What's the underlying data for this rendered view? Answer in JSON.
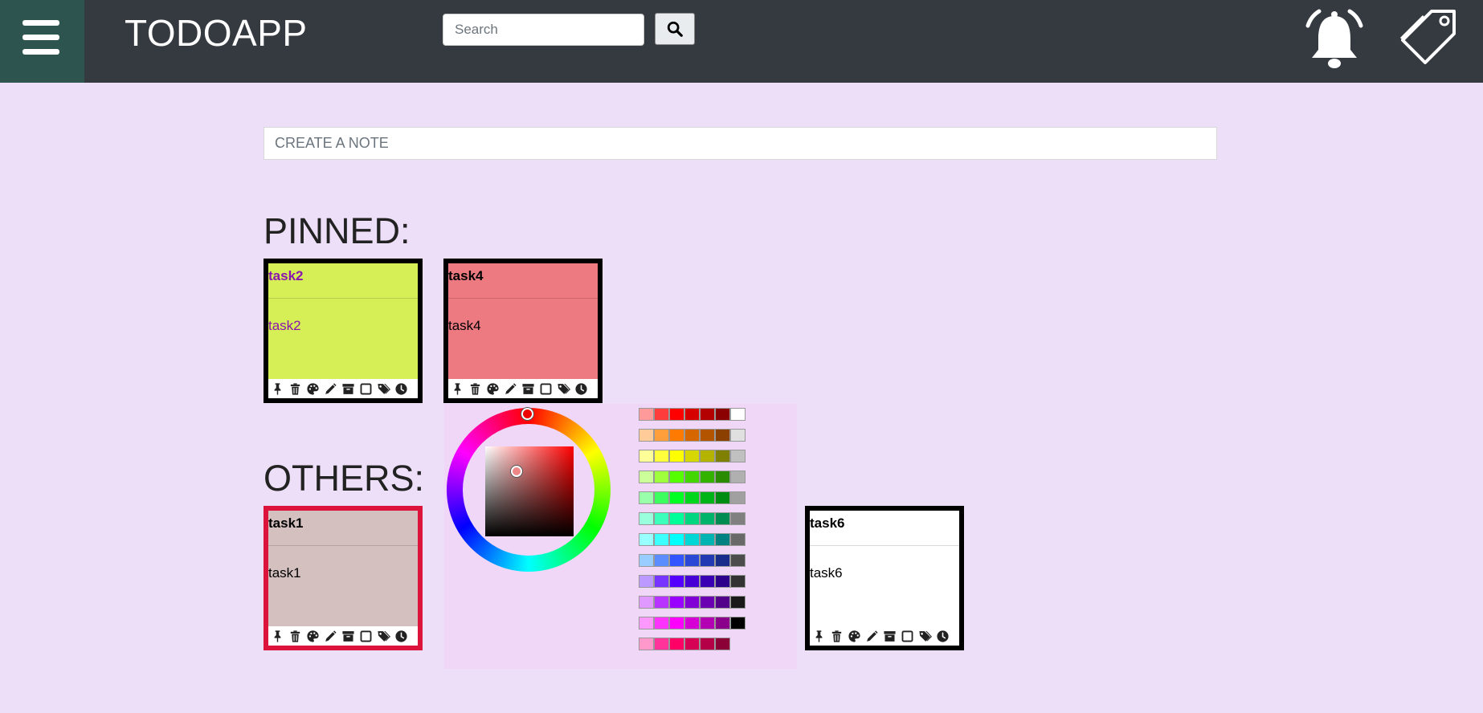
{
  "header": {
    "title": "TODOAPP",
    "search_placeholder": "Search",
    "colors": {
      "bar": "#343a40",
      "menu": "#2d544e"
    }
  },
  "create_note": {
    "placeholder": "CREATE A NOTE"
  },
  "sections": {
    "pinned": "PINNED:",
    "others": "OTHERS:"
  },
  "notes": {
    "task2": {
      "title": "task2",
      "text": "task2",
      "bg": "#d6ef56",
      "fg": "#8a14b0",
      "border": "#000000"
    },
    "task4": {
      "title": "task4",
      "text": "task4",
      "bg": "#ec7a80",
      "fg": "#000000",
      "border": "#000000"
    },
    "task1": {
      "title": "task1",
      "text": "task1",
      "bg": "#d3c0bf",
      "fg": "#000000",
      "border": "#dc143c"
    },
    "task6": {
      "title": "task6",
      "text": "task6",
      "bg": "#ffffff",
      "fg": "#000000",
      "border": "#000000"
    }
  },
  "note_toolbar_icons": [
    "pin-icon",
    "trash-icon",
    "palette-icon",
    "pencil-icon",
    "archive-icon",
    "checkbox-icon",
    "tags-icon",
    "clock-icon"
  ],
  "color_picker": {
    "selected_hue": "#ff0000",
    "swatches": [
      [
        "#ff9a9a",
        "#ff3c3c",
        "#ff0000",
        "#d60000",
        "#b30000",
        "#8b0000",
        "#ffffff"
      ],
      [
        "#ffcc99",
        "#ff9f3c",
        "#ff7a00",
        "#d66600",
        "#b35500",
        "#8b4000",
        "#e0e0e0"
      ],
      [
        "#ffff99",
        "#ffff3c",
        "#ffff00",
        "#d6d600",
        "#b3b300",
        "#808000",
        "#c0c0c0"
      ],
      [
        "#ccff99",
        "#9fff3c",
        "#55ff00",
        "#44d600",
        "#33b300",
        "#2b8b00",
        "#b0b0b0"
      ],
      [
        "#99ffaa",
        "#3cff5f",
        "#00ff22",
        "#00d61c",
        "#00b317",
        "#008b12",
        "#a0a0a0"
      ],
      [
        "#99ffdd",
        "#3cffbb",
        "#00ff99",
        "#00d680",
        "#00b36b",
        "#008b53",
        "#808080"
      ],
      [
        "#99ffff",
        "#3cffff",
        "#00ffff",
        "#00d6d6",
        "#00b3b3",
        "#008080",
        "#696969"
      ],
      [
        "#99ccff",
        "#5c8dff",
        "#3355ff",
        "#2b47d6",
        "#2239b3",
        "#1a2c8b",
        "#4c4c4c"
      ],
      [
        "#bb99ff",
        "#7733ff",
        "#5500ff",
        "#4600d6",
        "#3a00b3",
        "#2d008b",
        "#333333"
      ],
      [
        "#e099ff",
        "#b833ff",
        "#9900ff",
        "#8000d6",
        "#6b00b3",
        "#53008b",
        "#1a1a1a"
      ],
      [
        "#ff99ff",
        "#ff33ff",
        "#ff00ff",
        "#d600d6",
        "#b300b3",
        "#8b008b",
        "#000000"
      ],
      [
        "#ff99cc",
        "#ff3399",
        "#ff0066",
        "#d60055",
        "#b30047",
        "#8b0037"
      ]
    ]
  }
}
